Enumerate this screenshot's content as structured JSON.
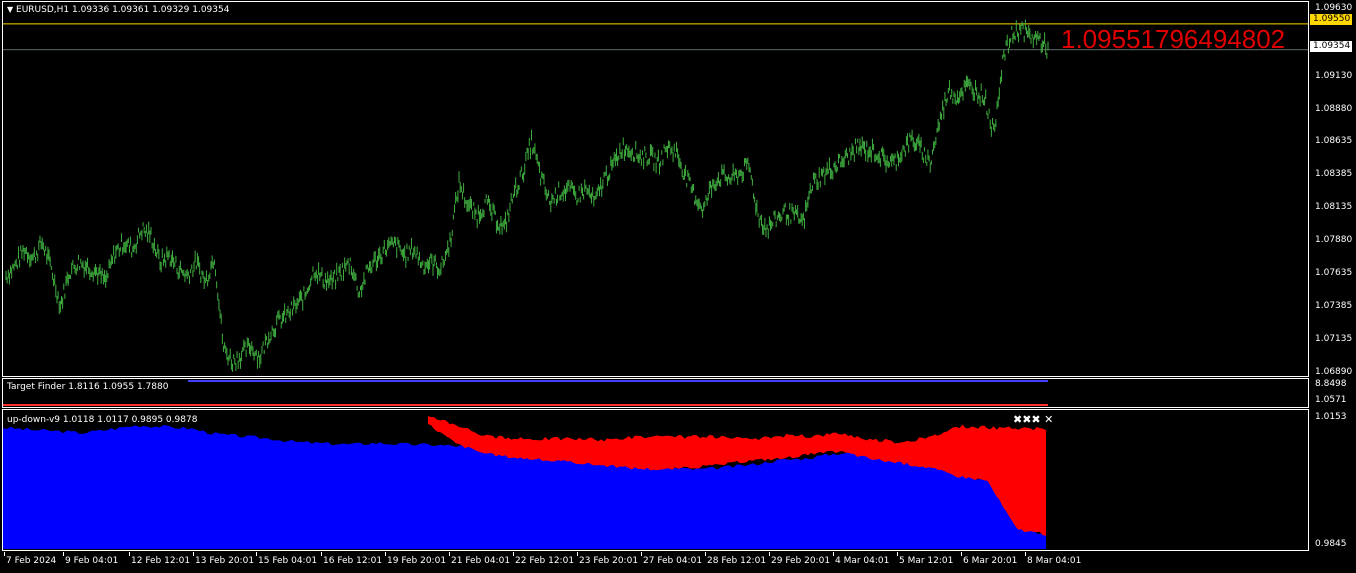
{
  "chart": {
    "symbol_info": "EURUSD,H1  1.09336 1.09361 1.09329 1.09354",
    "big_price": "1.09551796494802",
    "price_scale": [
      "1.09630",
      "1.09354",
      "1.09130",
      "1.08880",
      "1.08635",
      "1.08385",
      "1.08135",
      "1.07880",
      "1.07635",
      "1.07385",
      "1.07135",
      "1.06890"
    ],
    "current_price": "1.09354",
    "level_price": "1.09550"
  },
  "target_finder": {
    "title": "Target Finder 1.8116 1.0955 1.7880",
    "scale": [
      "8.8498",
      "1.0571"
    ]
  },
  "up_down": {
    "title": "up-down-v9 1.0118 1.0117 0.9895 0.9878",
    "scale": [
      "1.0153",
      "0.9845"
    ]
  },
  "time_axis": [
    "7 Feb 2024",
    "9 Feb 04:01",
    "12 Feb 12:01",
    "13 Feb 20:01",
    "15 Feb 04:01",
    "16 Feb 12:01",
    "19 Feb 20:01",
    "21 Feb 04:01",
    "22 Feb 12:01",
    "23 Feb 20:01",
    "27 Feb 04:01",
    "28 Feb 12:01",
    "29 Feb 20:01",
    "4 Mar 04:01",
    "5 Mar 12:01",
    "6 Mar 20:01",
    "8 Mar 04:01"
  ],
  "colors": {
    "candle": "#3fae3f",
    "up_area": "#0000ff",
    "down_area": "#ff0000",
    "big_price": "#e00000",
    "level_line": "#ffd700"
  },
  "chart_data": {
    "type": "line",
    "ylim": [
      1.0689,
      1.097
    ],
    "close": [
      1.0765,
      1.0772,
      1.0785,
      1.0778,
      1.079,
      1.077,
      1.0742,
      1.0768,
      1.0775,
      1.0772,
      1.0768,
      1.076,
      1.0782,
      1.079,
      1.0785,
      1.08,
      1.0795,
      1.0775,
      1.078,
      1.077,
      1.0765,
      1.0775,
      1.076,
      1.078,
      1.071,
      1.07,
      1.0705,
      1.0712,
      1.0703,
      1.072,
      1.073,
      1.0735,
      1.0742,
      1.075,
      1.077,
      1.0762,
      1.076,
      1.0768,
      1.0775,
      1.0752,
      1.077,
      1.0778,
      1.0786,
      1.0788,
      1.078,
      1.0785,
      1.0773,
      1.0775,
      1.077,
      1.079,
      1.0835,
      1.0818,
      1.081,
      1.082,
      1.0808,
      1.08,
      1.0826,
      1.0842,
      1.0866,
      1.084,
      1.082,
      1.0828,
      1.083,
      1.0825,
      1.083,
      1.082,
      1.0838,
      1.0848,
      1.0862,
      1.086,
      1.0855,
      1.0855,
      1.085,
      1.0862,
      1.0858,
      1.084,
      1.0825,
      1.0815,
      1.0835,
      1.084,
      1.0838,
      1.0842,
      1.0848,
      1.081,
      1.08,
      1.0808,
      1.0813,
      1.081,
      1.0805,
      1.0835,
      1.084,
      1.0845,
      1.085,
      1.0855,
      1.0862,
      1.086,
      1.0858,
      1.0852,
      1.085,
      1.086,
      1.0868,
      1.086,
      1.085,
      1.088,
      1.0905,
      1.09,
      1.0908,
      1.0905,
      1.09,
      1.0872,
      1.0928,
      1.0946,
      1.0952,
      1.0945,
      1.0944,
      1.0935
    ],
    "up_down": {
      "ylim": [
        0.9845,
        1.0153
      ],
      "red_top": [
        1.0148,
        1.0126,
        1.01,
        1.0094,
        1.0095,
        1.0095,
        1.0092,
        1.0099,
        1.0098,
        1.01,
        1.0098,
        1.0092,
        1.0102,
        1.01,
        1.0108,
        1.0093,
        1.0088,
        1.0096,
        1.0123,
        1.012,
        1.0118,
        1.0117
      ],
      "red_bottom": [
        1.0128,
        1.0082,
        1.006,
        1.0052,
        1.0046,
        1.0041,
        1.0034,
        1.0028,
        1.0025,
        1.003,
        1.0036,
        1.0046,
        1.005,
        1.006,
        1.0066,
        1.005,
        1.004,
        1.003,
        1.001,
        1.0,
        0.989,
        0.9878
      ]
    }
  }
}
